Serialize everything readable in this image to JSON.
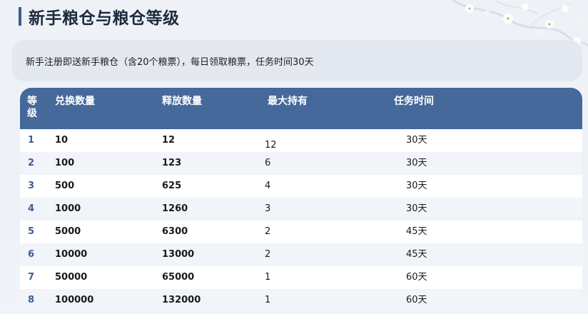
{
  "title": "新手粮仓与粮仓等级",
  "notice": "新手注册即送新手粮仓（含20个粮票），每日领取粮票，任务时间30天",
  "table": {
    "headers": {
      "level": "等级",
      "exchange": "兑换数量",
      "release": "释放数量",
      "max_hold": "最大持有",
      "duration": "任务时间"
    },
    "rows": [
      {
        "level": "1",
        "exchange": "10",
        "release": "12",
        "max_hold": "12",
        "duration": "30天"
      },
      {
        "level": "2",
        "exchange": "100",
        "release": "123",
        "max_hold": "6",
        "duration": "30天"
      },
      {
        "level": "3",
        "exchange": "500",
        "release": "625",
        "max_hold": "4",
        "duration": "30天"
      },
      {
        "level": "4",
        "exchange": "1000",
        "release": "1260",
        "max_hold": "3",
        "duration": "30天"
      },
      {
        "level": "5",
        "exchange": "5000",
        "release": "6300",
        "max_hold": "2",
        "duration": "45天"
      },
      {
        "level": "6",
        "exchange": "10000",
        "release": "13000",
        "max_hold": "2",
        "duration": "45天"
      },
      {
        "level": "7",
        "exchange": "50000",
        "release": "65000",
        "max_hold": "1",
        "duration": "60天"
      },
      {
        "level": "8",
        "exchange": "100000",
        "release": "132000",
        "max_hold": "1",
        "duration": "60天"
      }
    ]
  },
  "colors": {
    "header_bg": "#44699a",
    "accent": "#3d5e8b",
    "level_text": "#3a5f94",
    "page_bg": "#edf1f6"
  },
  "icons": {
    "decor": "plum-blossom-branch"
  }
}
